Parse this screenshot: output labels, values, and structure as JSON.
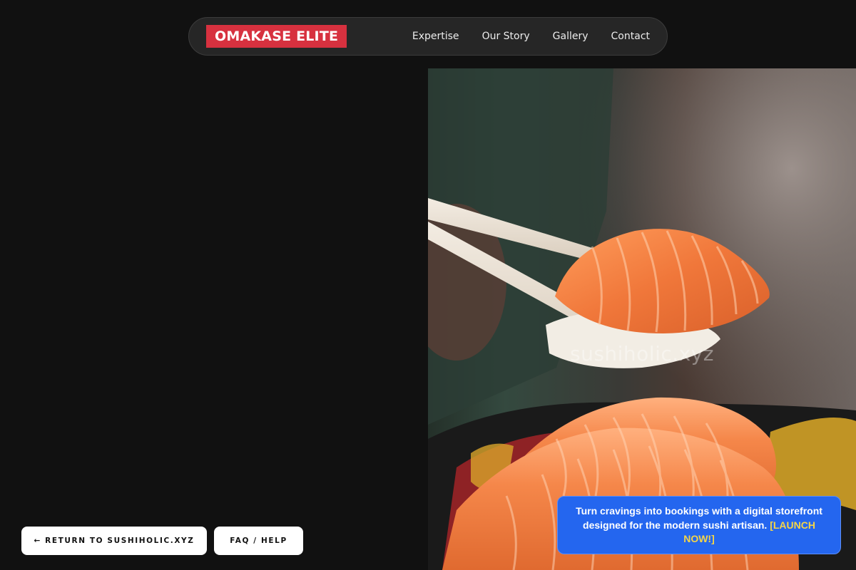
{
  "header": {
    "brand": "OMAKASE ELITE",
    "nav": [
      {
        "label": "Expertise"
      },
      {
        "label": "Our Story"
      },
      {
        "label": "Gallery"
      },
      {
        "label": "Contact"
      }
    ]
  },
  "hero": {
    "watermark": "sushiholic.xyz"
  },
  "buttons": {
    "return_label": "← RETURN TO SUSHIHOLIC.XYZ",
    "faq_label": "FAQ / HELP"
  },
  "promo": {
    "text": "Turn cravings into bookings with a digital storefront designed for the modern sushi artisan.",
    "cta": "[LAUNCH NOW!]"
  },
  "colors": {
    "background": "#111111",
    "brand_red": "#d7313f",
    "promo_blue": "#2466ef",
    "cta_yellow": "#f5d547"
  }
}
